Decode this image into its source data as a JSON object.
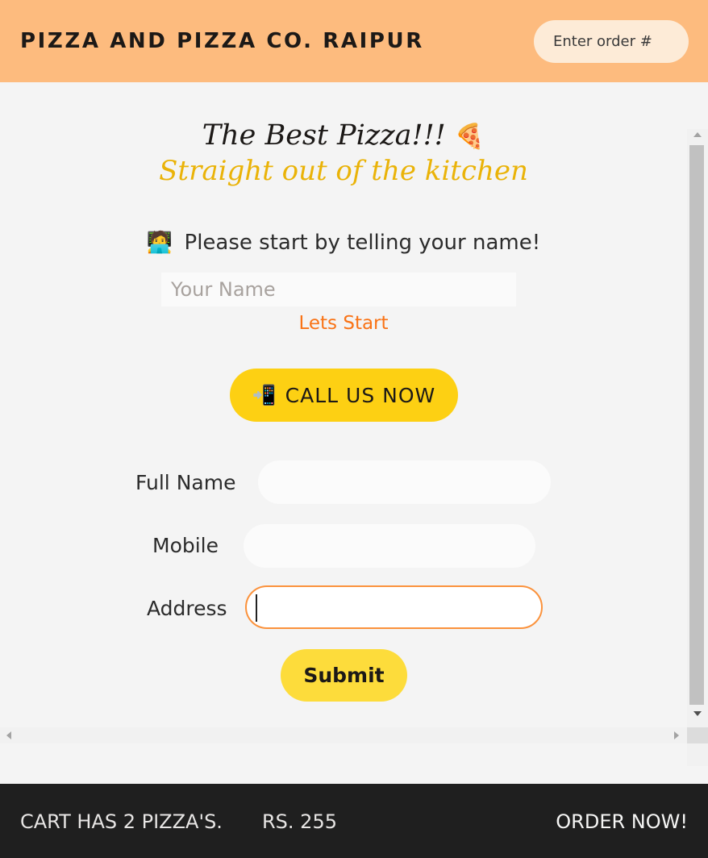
{
  "header": {
    "brand": "PIZZA AND PIZZA CO. RAIPUR",
    "order_search_placeholder": "Enter order #"
  },
  "hero": {
    "title": "The Best Pizza!!!",
    "title_icon": "🍕",
    "subtitle": "Straight out of the kitchen"
  },
  "start": {
    "prompt_icon": "🧑‍💻",
    "prompt": "Please start by telling your name!",
    "name_placeholder": "Your Name",
    "start_label": "Lets Start"
  },
  "call": {
    "icon": "📲",
    "label": "CALL US NOW"
  },
  "order_form": {
    "full_name_label": "Full Name",
    "full_name_value": "",
    "mobile_label": "Mobile",
    "mobile_value": "",
    "address_label": "Address",
    "address_value": "",
    "submit_label": "Submit"
  },
  "footer": {
    "cart_count": "CART HAS 2 PIZZA'S.",
    "cart_total": "RS. 255",
    "order_now": "ORDER NOW!"
  },
  "colors": {
    "header_bg": "#fdbb7e",
    "accent_yellow": "#fdd013",
    "accent_orange": "#f97316",
    "subtitle_yellow": "#eab308",
    "footer_bg": "#1f1f1f"
  }
}
